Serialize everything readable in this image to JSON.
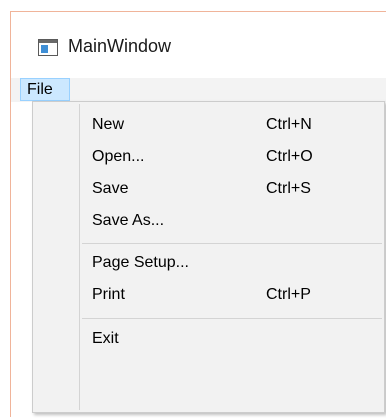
{
  "window": {
    "title": "MainWindow"
  },
  "menubar": {
    "items": [
      {
        "label": "File"
      }
    ]
  },
  "file_menu": {
    "items": [
      {
        "label": "New",
        "shortcut": "Ctrl+N"
      },
      {
        "label": "Open...",
        "shortcut": "Ctrl+O"
      },
      {
        "label": "Save",
        "shortcut": "Ctrl+S"
      },
      {
        "label": "Save As...",
        "shortcut": ""
      },
      {
        "label": "Page Setup...",
        "shortcut": ""
      },
      {
        "label": "Print",
        "shortcut": "Ctrl+P"
      },
      {
        "label": "Exit",
        "shortcut": ""
      }
    ]
  },
  "colors": {
    "window_border": "#f0b49a",
    "menu_highlight": "#cce8ff",
    "menu_highlight_border": "#99d1ff",
    "menu_background": "#f2f2f2"
  },
  "icons": {
    "app": "window-app-icon"
  }
}
